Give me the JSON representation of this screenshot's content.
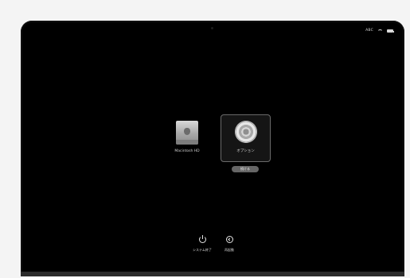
{
  "status_bar": {
    "input_source": "ABC"
  },
  "startup_disks": [
    {
      "label": "Macintosh HD"
    }
  ],
  "options": {
    "label": "オプション",
    "button_label": "続ける"
  },
  "actions": {
    "shutdown_label": "システム終了",
    "restart_label": "再起動"
  },
  "icons": {
    "disk": "internal-disk-icon",
    "options": "gear-icon",
    "wifi": "wifi-icon",
    "battery": "battery-icon",
    "shutdown": "power-icon",
    "restart": "restart-icon"
  },
  "colors": {
    "background": "#f4f4f4",
    "screen": "#000000",
    "selection_border": "#6a6a6a",
    "button": "#666666"
  }
}
